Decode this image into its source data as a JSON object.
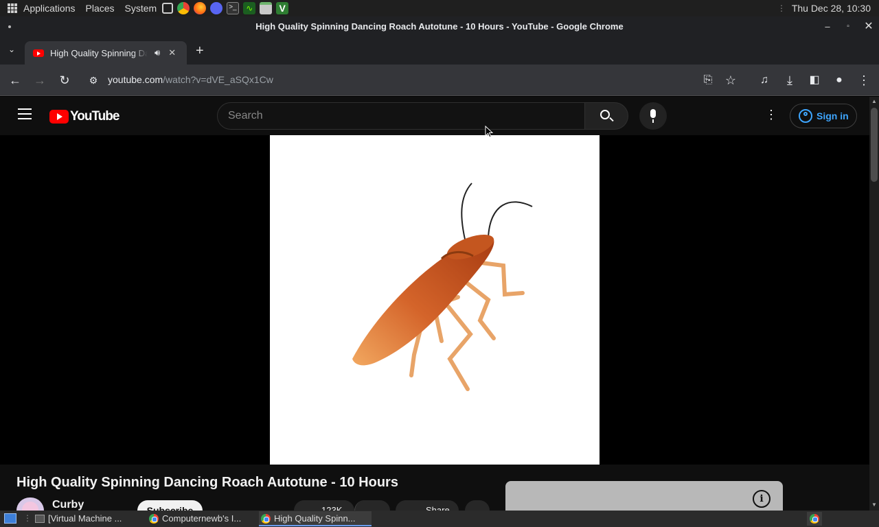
{
  "panel": {
    "applications": "Applications",
    "places": "Places",
    "system": "System",
    "clock": "Thu Dec 28, 10:30",
    "launchers": [
      "screenshot-icon",
      "chrome-icon",
      "firefox-icon",
      "discord-icon",
      "terminal-icon",
      "monitor-icon",
      "files-icon",
      "vim-icon"
    ]
  },
  "window": {
    "title": "High Quality Spinning Dancing Roach Autotune - 10 Hours - YouTube - Google Chrome"
  },
  "tabs": [
    {
      "title": "High Quality Spinning Dancing Roach Autotune - 10 Hours - YouTube"
    }
  ],
  "toolbar": {
    "url_host": "youtube.com",
    "url_path": "/watch?v=dVE_aSQx1Cw"
  },
  "youtube": {
    "logo": "YouTube",
    "search_placeholder": "Search",
    "sign_in": "Sign in"
  },
  "video": {
    "title": "High Quality Spinning Dancing Roach Autotune - 10 Hours",
    "channel": "Curby",
    "subscribe": "Subscribe",
    "likes": "123K",
    "share": "Share"
  },
  "taskbar": {
    "items": [
      {
        "label": "[Virtual Machine ..."
      },
      {
        "label": "Computernewb's I..."
      },
      {
        "label": "High Quality Spinn..."
      }
    ]
  },
  "colors": {
    "youtube_red": "#ff0000",
    "link_blue": "#3ea6ff",
    "chrome_dark": "#202124"
  }
}
